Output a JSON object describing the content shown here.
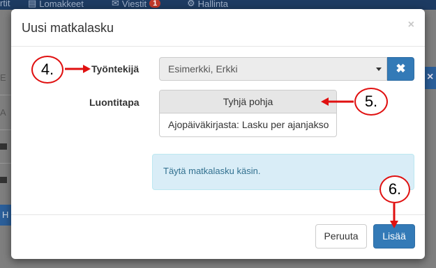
{
  "background": {
    "nav_items": [
      {
        "label": "rtit"
      },
      {
        "label": "Lomakkeet"
      },
      {
        "label": "Viestit",
        "badge": "1"
      },
      {
        "label": "Hallinta"
      }
    ],
    "side_letters": [
      "E",
      "A",
      "H"
    ],
    "right_x": "×"
  },
  "modal": {
    "title": "Uusi matkalasku",
    "close_symbol": "×",
    "employee_label": "Työntekijä",
    "employee_value": "Esimerkki, Erkki",
    "clear_symbol": "✖",
    "creation_label": "Luontitapa",
    "creation_options": [
      {
        "label": "Tyhjä pohja",
        "selected": true
      },
      {
        "label": "Ajopäiväkirjasta: Lasku per ajanjakso",
        "selected": false
      }
    ],
    "info_text": "Täytä matkalasku käsin.",
    "cancel_label": "Peruuta",
    "add_label": "Lisää"
  },
  "annotations": [
    {
      "number": "4."
    },
    {
      "number": "5."
    },
    {
      "number": "6."
    }
  ],
  "colors": {
    "primary": "#337ab7",
    "callout_red": "#e01010",
    "info_bg": "#d9edf7",
    "info_text": "#31708f",
    "topbar": "#1d3b62"
  }
}
